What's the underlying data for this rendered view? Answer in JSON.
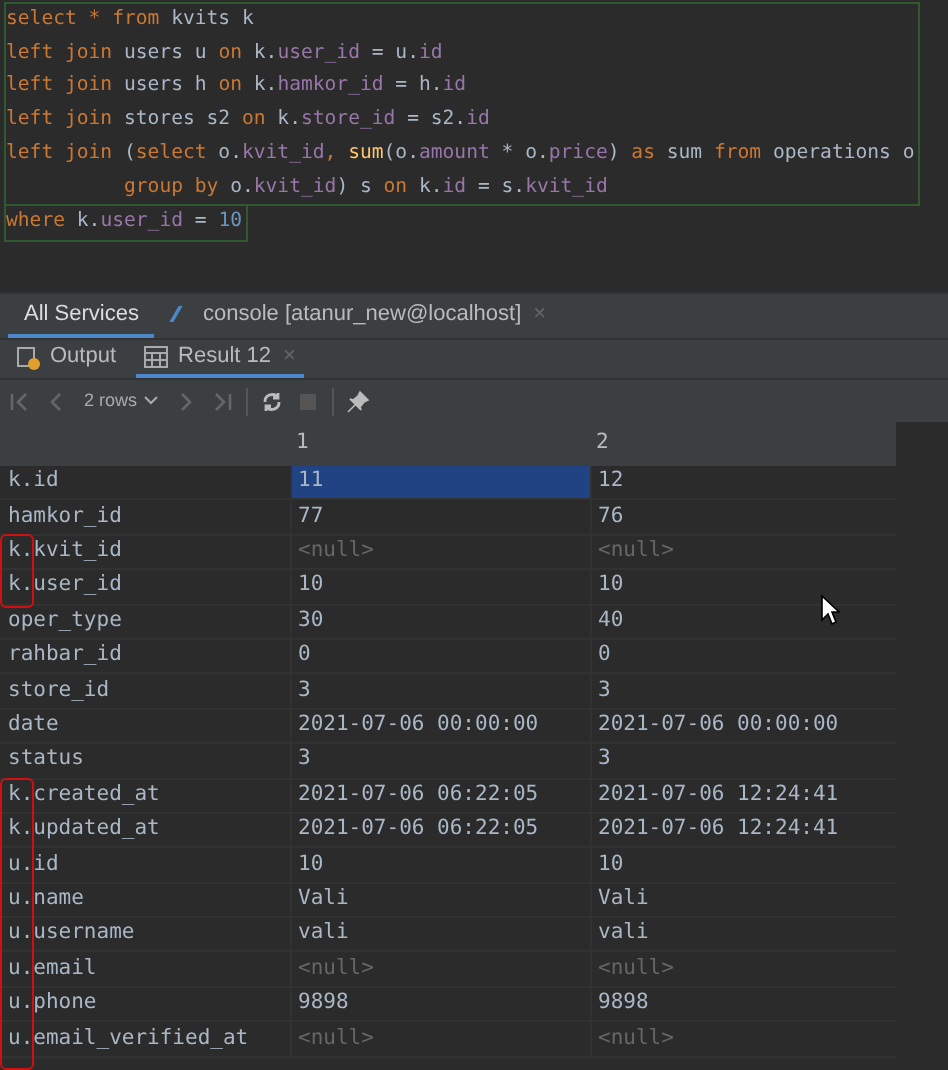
{
  "editor": {
    "lines": [
      [
        {
          "text": "select",
          "kind": "keyword"
        },
        {
          "text": " * ",
          "kind": "keyword"
        },
        {
          "text": "from",
          "kind": "keyword"
        },
        {
          "text": " kvits k",
          "kind": "plain"
        }
      ],
      [
        {
          "text": "left join",
          "kind": "keyword"
        },
        {
          "text": " users u ",
          "kind": "plain"
        },
        {
          "text": "on",
          "kind": "keyword"
        },
        {
          "text": " k.",
          "kind": "plain"
        },
        {
          "text": "user_id",
          "kind": "column"
        },
        {
          "text": " = u.",
          "kind": "plain"
        },
        {
          "text": "id",
          "kind": "column"
        }
      ],
      [
        {
          "text": "left join",
          "kind": "keyword"
        },
        {
          "text": " users h ",
          "kind": "plain"
        },
        {
          "text": "on",
          "kind": "keyword"
        },
        {
          "text": " k.",
          "kind": "plain"
        },
        {
          "text": "hamkor_id",
          "kind": "column"
        },
        {
          "text": " = h.",
          "kind": "plain"
        },
        {
          "text": "id",
          "kind": "column"
        }
      ],
      [
        {
          "text": "left join",
          "kind": "keyword"
        },
        {
          "text": " stores s2 ",
          "kind": "plain"
        },
        {
          "text": "on",
          "kind": "keyword"
        },
        {
          "text": " k.",
          "kind": "plain"
        },
        {
          "text": "store_id",
          "kind": "column"
        },
        {
          "text": " = s2.",
          "kind": "plain"
        },
        {
          "text": "id",
          "kind": "column"
        }
      ],
      [
        {
          "text": "left join",
          "kind": "keyword"
        },
        {
          "text": " (",
          "kind": "plain"
        },
        {
          "text": "select",
          "kind": "keyword"
        },
        {
          "text": " o.",
          "kind": "plain"
        },
        {
          "text": "kvit_id",
          "kind": "column"
        },
        {
          "text": ", ",
          "kind": "keyword"
        },
        {
          "text": "sum",
          "kind": "function"
        },
        {
          "text": "(o.",
          "kind": "plain"
        },
        {
          "text": "amount",
          "kind": "column"
        },
        {
          "text": " * o.",
          "kind": "plain"
        },
        {
          "text": "price",
          "kind": "column"
        },
        {
          "text": ") ",
          "kind": "plain"
        },
        {
          "text": "as",
          "kind": "keyword"
        },
        {
          "text": " sum ",
          "kind": "plain"
        },
        {
          "text": "from",
          "kind": "keyword"
        },
        {
          "text": " operations o",
          "kind": "plain"
        }
      ],
      [
        {
          "text": "group by",
          "kind": "keyword",
          "indent": true
        },
        {
          "text": " o.",
          "kind": "plain"
        },
        {
          "text": "kvit_id",
          "kind": "column"
        },
        {
          "text": ") s ",
          "kind": "plain"
        },
        {
          "text": "on",
          "kind": "keyword"
        },
        {
          "text": " k.",
          "kind": "plain"
        },
        {
          "text": "id",
          "kind": "column"
        },
        {
          "text": " = s.",
          "kind": "plain"
        },
        {
          "text": "kvit_id",
          "kind": "column"
        }
      ],
      [
        {
          "text": "where",
          "kind": "keyword"
        },
        {
          "text": " k.",
          "kind": "plain"
        },
        {
          "text": "user_id",
          "kind": "column"
        },
        {
          "text": " = ",
          "kind": "plain"
        },
        {
          "text": "10",
          "kind": "number"
        }
      ]
    ]
  },
  "service_tabs": [
    {
      "label": "All Services",
      "selected": true
    },
    {
      "label": "console [atanur_new@localhost]",
      "selected": false,
      "close": "×"
    }
  ],
  "result_tabs": [
    {
      "label": "Output",
      "selected": false
    },
    {
      "label": "Result 12",
      "selected": true,
      "close": "×"
    }
  ],
  "toolbar": {
    "rows_label": "2 rows"
  },
  "table": {
    "columns": [
      "1",
      "2"
    ],
    "rows": [
      {
        "label": "k.id",
        "cells": [
          {
            "text": "11",
            "kind": "value",
            "selected": true
          },
          {
            "text": "12",
            "kind": "value",
            "selected": false
          }
        ]
      },
      {
        "label": "hamkor_id",
        "cells": [
          {
            "text": "77",
            "kind": "value",
            "selected": false
          },
          {
            "text": "76",
            "kind": "value",
            "selected": false
          }
        ]
      },
      {
        "label": "k.kvit_id",
        "cells": [
          {
            "text": "<null>",
            "kind": "null",
            "selected": false
          },
          {
            "text": "<null>",
            "kind": "null",
            "selected": false
          }
        ]
      },
      {
        "label": "k.user_id",
        "cells": [
          {
            "text": "10",
            "kind": "value",
            "selected": false
          },
          {
            "text": "10",
            "kind": "value",
            "selected": false
          }
        ]
      },
      {
        "label": "oper_type",
        "cells": [
          {
            "text": "30",
            "kind": "value",
            "selected": false
          },
          {
            "text": "40",
            "kind": "value",
            "selected": false
          }
        ]
      },
      {
        "label": "rahbar_id",
        "cells": [
          {
            "text": "0",
            "kind": "value",
            "selected": false
          },
          {
            "text": "0",
            "kind": "value",
            "selected": false
          }
        ]
      },
      {
        "label": "store_id",
        "cells": [
          {
            "text": "3",
            "kind": "value",
            "selected": false
          },
          {
            "text": "3",
            "kind": "value",
            "selected": false
          }
        ]
      },
      {
        "label": "date",
        "cells": [
          {
            "text": "2021-07-06 00:00:00",
            "kind": "value",
            "selected": false
          },
          {
            "text": "2021-07-06 00:00:00",
            "kind": "value",
            "selected": false
          }
        ]
      },
      {
        "label": "status",
        "cells": [
          {
            "text": "3",
            "kind": "value",
            "selected": false
          },
          {
            "text": "3",
            "kind": "value",
            "selected": false
          }
        ]
      },
      {
        "label": "k.created_at",
        "cells": [
          {
            "text": "2021-07-06 06:22:05",
            "kind": "value",
            "selected": false
          },
          {
            "text": "2021-07-06 12:24:41",
            "kind": "value",
            "selected": false
          }
        ]
      },
      {
        "label": "k.updated_at",
        "cells": [
          {
            "text": "2021-07-06 06:22:05",
            "kind": "value",
            "selected": false
          },
          {
            "text": "2021-07-06 12:24:41",
            "kind": "value",
            "selected": false
          }
        ]
      },
      {
        "label": "u.id",
        "cells": [
          {
            "text": "10",
            "kind": "value",
            "selected": false
          },
          {
            "text": "10",
            "kind": "value",
            "selected": false
          }
        ]
      },
      {
        "label": "u.name",
        "cells": [
          {
            "text": "Vali",
            "kind": "value",
            "selected": false
          },
          {
            "text": "Vali",
            "kind": "value",
            "selected": false
          }
        ]
      },
      {
        "label": "u.username",
        "cells": [
          {
            "text": "vali",
            "kind": "value",
            "selected": false
          },
          {
            "text": "vali",
            "kind": "value",
            "selected": false
          }
        ]
      },
      {
        "label": "u.email",
        "cells": [
          {
            "text": "<null>",
            "kind": "null",
            "selected": false
          },
          {
            "text": "<null>",
            "kind": "null",
            "selected": false
          }
        ]
      },
      {
        "label": "u.phone",
        "cells": [
          {
            "text": "9898",
            "kind": "value",
            "selected": false
          },
          {
            "text": "9898",
            "kind": "value",
            "selected": false
          }
        ]
      },
      {
        "label": "u.email_verified_at",
        "cells": [
          {
            "text": "<null>",
            "kind": "null",
            "selected": false
          },
          {
            "text": "<null>",
            "kind": "null",
            "selected": false
          }
        ]
      }
    ]
  }
}
